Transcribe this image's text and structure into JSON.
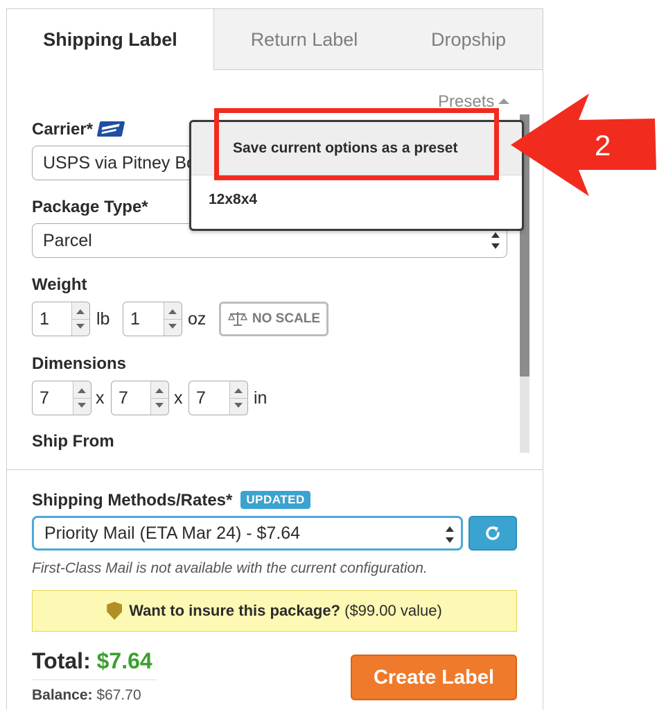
{
  "tabs": {
    "shipping_label": "Shipping Label",
    "return_label": "Return Label",
    "dropship": "Dropship"
  },
  "presets": {
    "label": "Presets",
    "menu_items": [
      "Save current options as a preset",
      "12x8x4"
    ]
  },
  "carrier": {
    "label": "Carrier*",
    "icon": "usps-eagle-icon",
    "value": "USPS via Pitney Bowes"
  },
  "package_type": {
    "label": "Package Type*",
    "value": "Parcel"
  },
  "weight": {
    "label": "Weight",
    "lb_value": "1",
    "lb_unit": "lb",
    "oz_value": "1",
    "oz_unit": "oz",
    "no_scale": "NO SCALE"
  },
  "dimensions": {
    "label": "Dimensions",
    "length": "7",
    "width": "7",
    "height": "7",
    "separator": "x",
    "unit": "in"
  },
  "ship_from": {
    "label": "Ship From"
  },
  "rates": {
    "label": "Shipping Methods/Rates*",
    "badge": "UPDATED",
    "selected": "Priority Mail (ETA Mar 24) - $7.64",
    "note": "First-Class Mail is not available with the current configuration."
  },
  "insurance": {
    "question": "Want to insure this package?",
    "value": "($99.00 value)"
  },
  "summary": {
    "total_label": "Total:",
    "total_amount": "$7.64",
    "balance_label": "Balance:",
    "balance_amount": "$67.70"
  },
  "actions": {
    "create_label": "Create Label"
  },
  "annotation": {
    "step_number": "2",
    "color": "#f22b1f"
  }
}
